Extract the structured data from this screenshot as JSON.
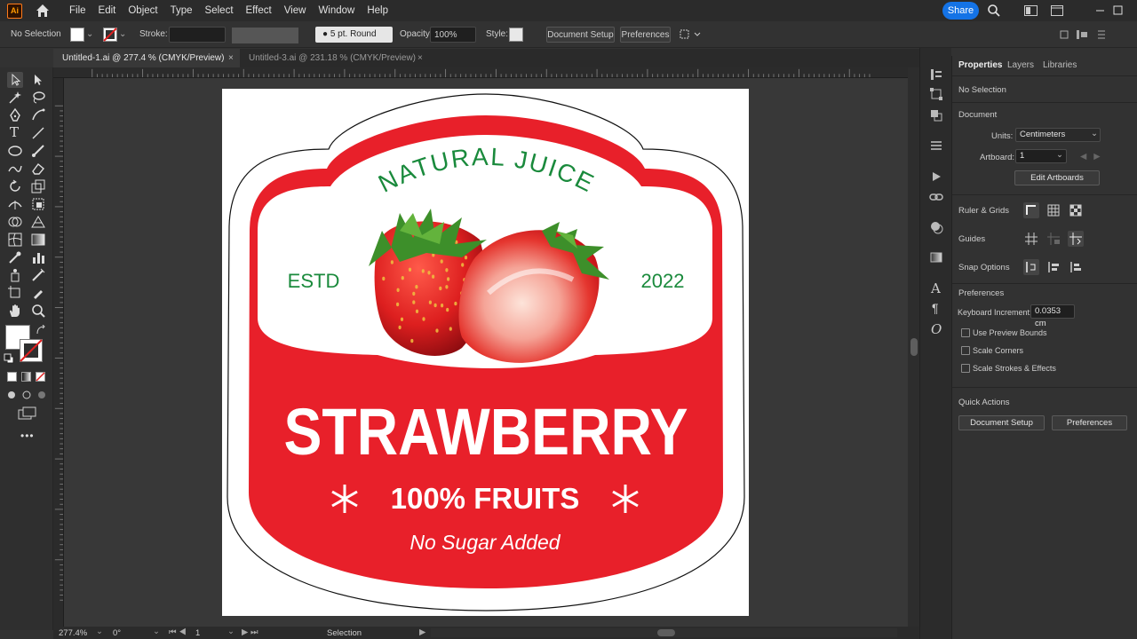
{
  "menubar": {
    "logo": "Ai",
    "items": [
      "File",
      "Edit",
      "Object",
      "Type",
      "Select",
      "Effect",
      "View",
      "Window",
      "Help"
    ],
    "share": "Share"
  },
  "controlbar": {
    "selection": "No Selection",
    "stroke_label": "Stroke:",
    "brush": "5 pt. Round",
    "opacity_label": "Opacity:",
    "opacity_value": "100%",
    "style_label": "Style:",
    "document_setup": "Document Setup",
    "preferences": "Preferences"
  },
  "tabs": [
    {
      "label": "Untitled-1.ai @ 277.4 % (CMYK/Preview)",
      "active": true
    },
    {
      "label": "Untitled-3.ai @ 231.18 % (CMYK/Preview)",
      "active": false
    }
  ],
  "artwork": {
    "arc_text": "NATURAL JUICE",
    "estd": "ESTD",
    "year": "2022",
    "title": "STRAWBERRY",
    "subtitle": "100% FRUITS",
    "tagline": "No Sugar Added",
    "red": "#e8202a",
    "green": "#1a8a3c"
  },
  "status": {
    "zoom": "277.4%",
    "rotation": "0°",
    "artboard": "1",
    "tool": "Selection"
  },
  "panel": {
    "tabs": [
      "Properties",
      "Layers",
      "Libraries"
    ],
    "no_selection": "No Selection",
    "document": "Document",
    "units_label": "Units:",
    "units_value": "Centimeters",
    "artboard_label": "Artboard:",
    "artboard_value": "1",
    "edit_artboards": "Edit Artboards",
    "ruler_grids": "Ruler & Grids",
    "guides": "Guides",
    "snap_options": "Snap Options",
    "preferences": "Preferences",
    "keyboard_increment_label": "Keyboard Increment:",
    "keyboard_increment_value": "0.0353 cm",
    "use_preview_bounds": "Use Preview Bounds",
    "scale_corners": "Scale Corners",
    "scale_strokes": "Scale Strokes & Effects",
    "quick_actions": "Quick Actions",
    "qa_document_setup": "Document Setup",
    "qa_preferences": "Preferences"
  }
}
